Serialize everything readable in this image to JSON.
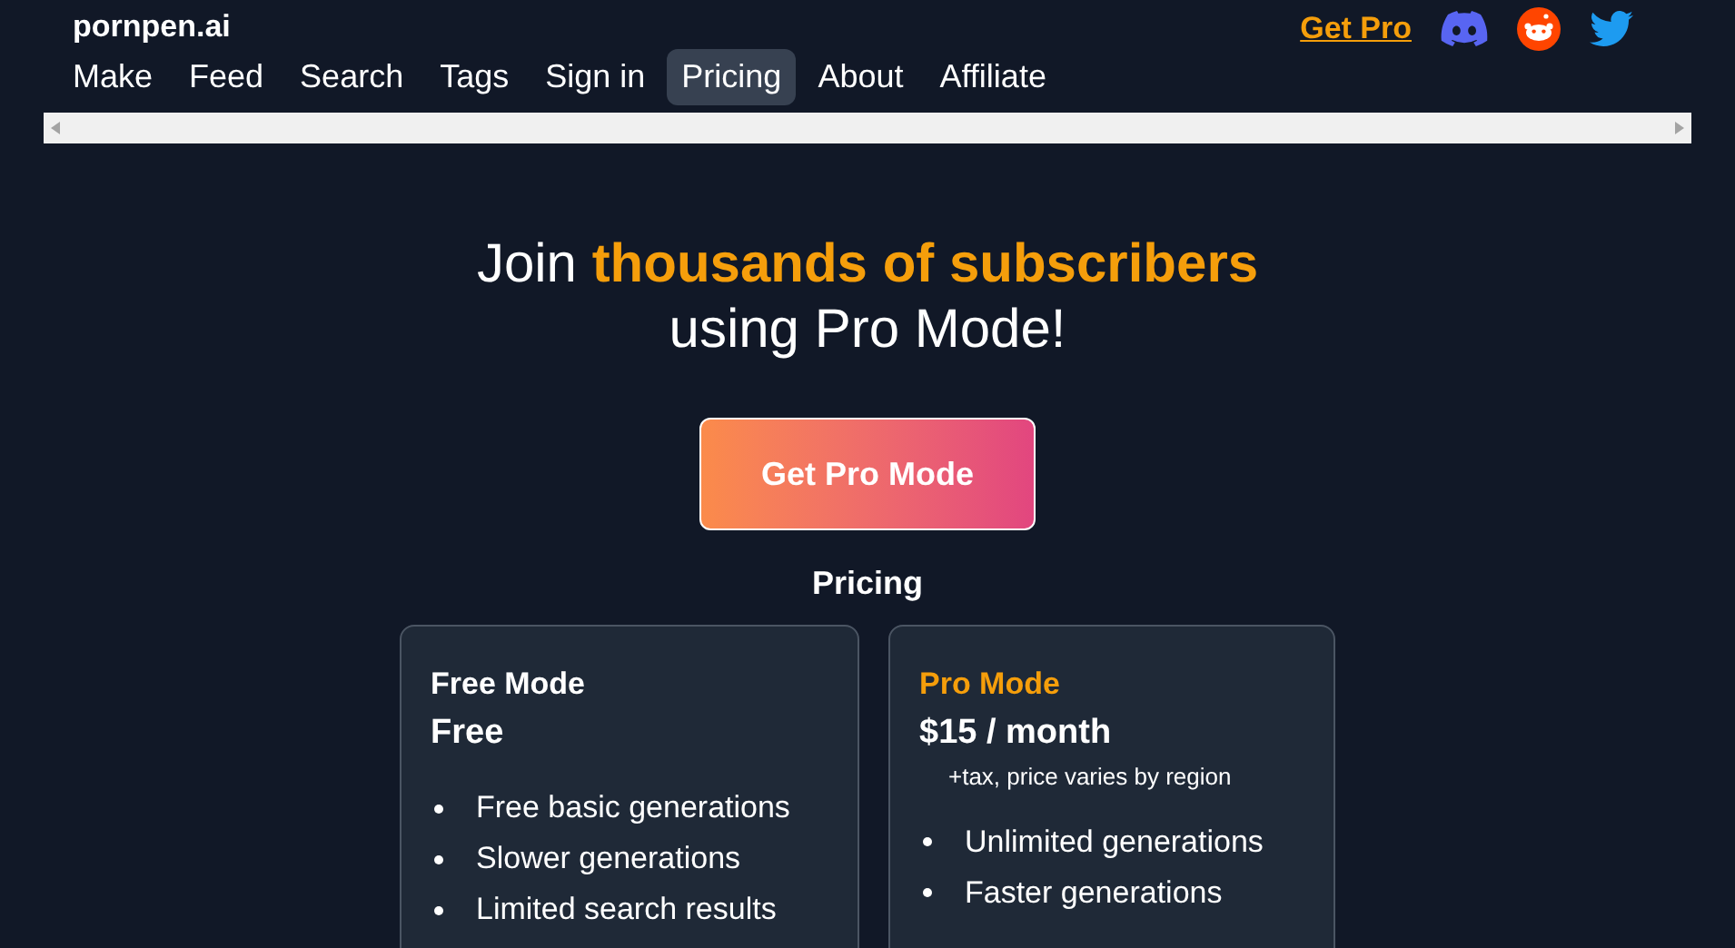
{
  "site": {
    "logo": "pornpen.ai",
    "get_pro": "Get Pro"
  },
  "nav": [
    {
      "label": "Make",
      "selected": false
    },
    {
      "label": "Feed",
      "selected": false
    },
    {
      "label": "Search",
      "selected": false
    },
    {
      "label": "Tags",
      "selected": false
    },
    {
      "label": "Sign in",
      "selected": false
    },
    {
      "label": "Pricing",
      "selected": true
    },
    {
      "label": "About",
      "selected": false
    },
    {
      "label": "Affiliate",
      "selected": false
    }
  ],
  "headline": "Join **thousands of subscribers** using Pro Mode!",
  "cta": "Get Pro Mode",
  "pricing_title": "Pricing",
  "plans": [
    {
      "name": "Free Mode",
      "highlighted": false,
      "price": "Free",
      "features": [
        "Free basic generations",
        "Slower generations",
        "Limited search results"
      ]
    },
    {
      "name": "Pro Mode",
      "highlighted": true,
      "price": "$15 / month",
      "price_note": "+tax, price varies by region",
      "features": [
        "Unlimited generations",
        "Faster generations"
      ]
    }
  ]
}
